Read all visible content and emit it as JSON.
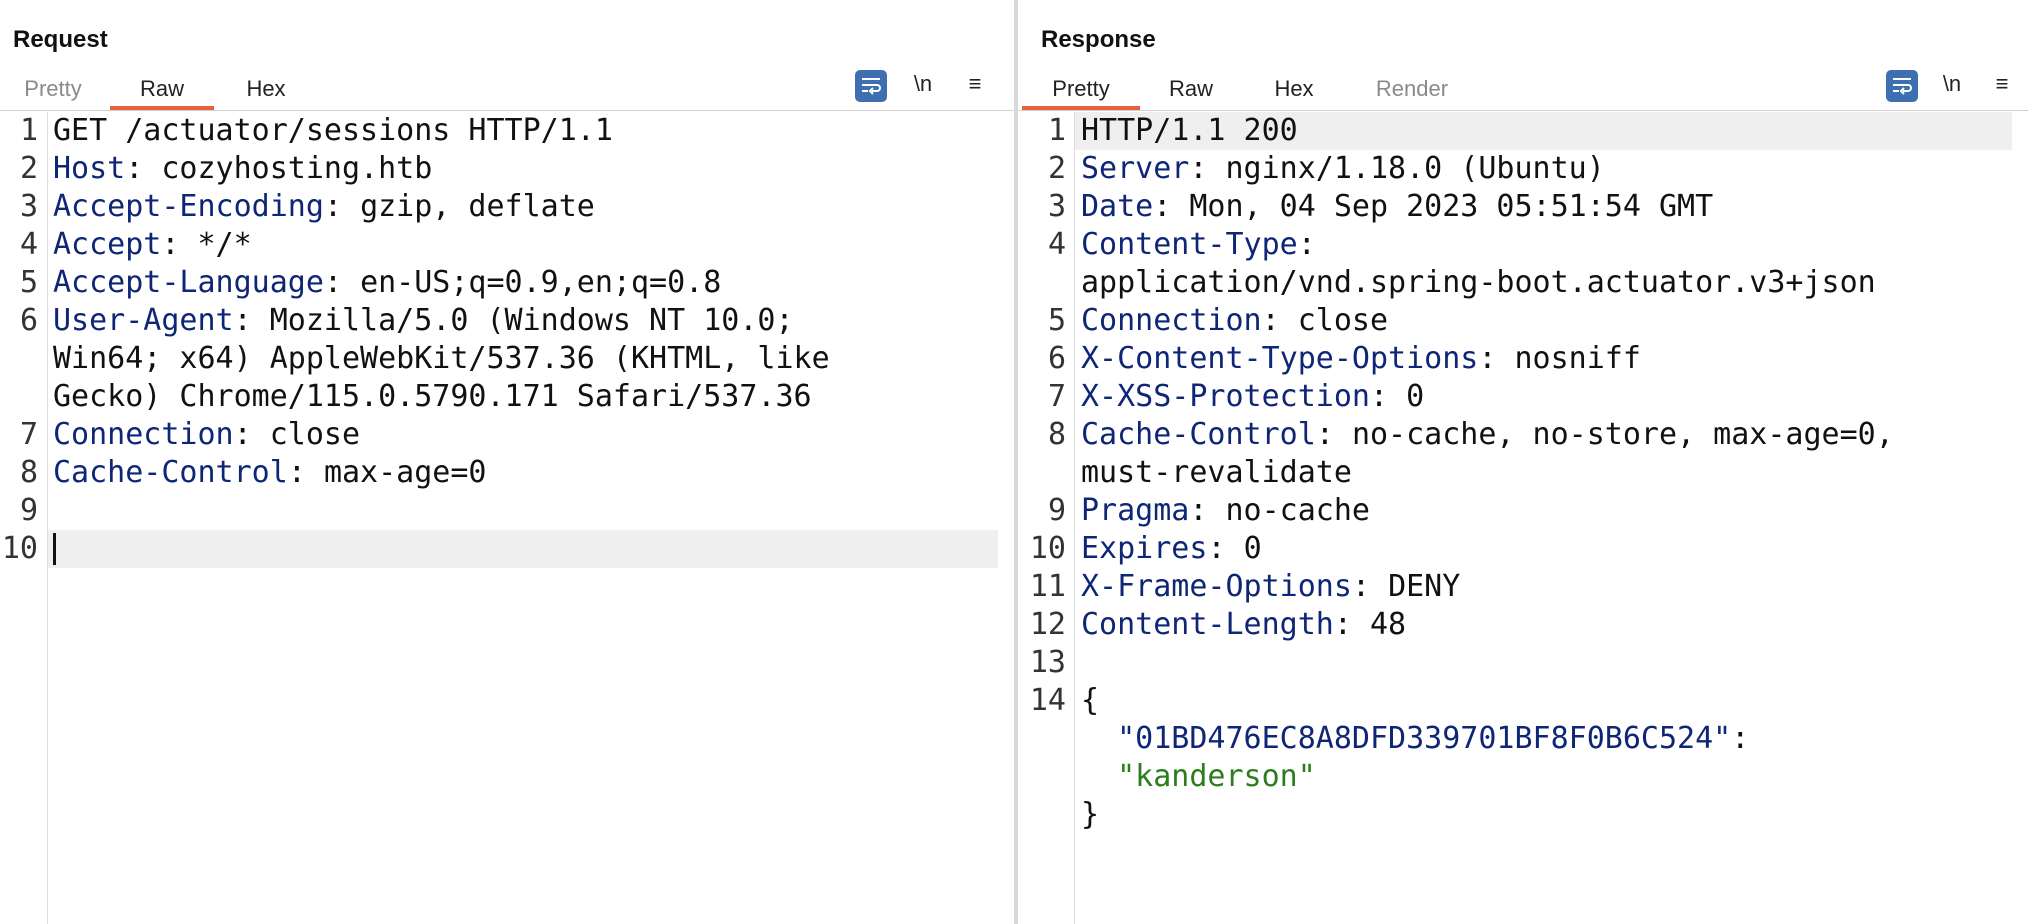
{
  "request": {
    "title": "Request",
    "tabs": [
      {
        "label": "Pretty",
        "active": false
      },
      {
        "label": "Raw",
        "active": true
      },
      {
        "label": "Hex",
        "active": false
      }
    ],
    "tools": {
      "wrap_icon": "wrap-lines-icon",
      "newline_label": "\\n",
      "menu_icon": "hamburger-menu-icon"
    },
    "lines": [
      {
        "n": "1",
        "text": "GET /actuator/sessions HTTP/1.1"
      },
      {
        "n": "2",
        "key": "Host",
        "val": "cozyhosting.htb"
      },
      {
        "n": "3",
        "key": "Accept-Encoding",
        "val": "gzip, deflate"
      },
      {
        "n": "4",
        "key": "Accept",
        "val": "*/*"
      },
      {
        "n": "5",
        "key": "Accept-Language",
        "val": "en-US;q=0.9,en;q=0.8"
      },
      {
        "n": "6",
        "key": "User-Agent",
        "val": "Mozilla/5.0 (Windows NT 10.0;"
      },
      {
        "n": "",
        "text": "Win64; x64) AppleWebKit/537.36 (KHTML, like"
      },
      {
        "n": "",
        "text": "Gecko) Chrome/115.0.5790.171 Safari/537.36"
      },
      {
        "n": "7",
        "key": "Connection",
        "val": "close"
      },
      {
        "n": "8",
        "key": "Cache-Control",
        "val": "max-age=0"
      },
      {
        "n": "9",
        "text": ""
      },
      {
        "n": "10",
        "text": ""
      }
    ]
  },
  "response": {
    "title": "Response",
    "tabs": [
      {
        "label": "Pretty",
        "active": true
      },
      {
        "label": "Raw",
        "active": false
      },
      {
        "label": "Hex",
        "active": false
      },
      {
        "label": "Render",
        "active": false,
        "dim": true
      }
    ],
    "tools": {
      "wrap_icon": "wrap-lines-icon",
      "newline_label": "\\n",
      "menu_icon": "hamburger-menu-icon"
    },
    "lines": [
      {
        "n": "1",
        "text": "HTTP/1.1 200"
      },
      {
        "n": "2",
        "key": "Server",
        "val": "nginx/1.18.0 (Ubuntu)"
      },
      {
        "n": "3",
        "key": "Date",
        "val": "Mon, 04 Sep 2023 05:51:54 GMT"
      },
      {
        "n": "4",
        "key": "Content-Type",
        "val": ""
      },
      {
        "n": "",
        "text": "application/vnd.spring-boot.actuator.v3+json"
      },
      {
        "n": "5",
        "key": "Connection",
        "val": "close"
      },
      {
        "n": "6",
        "key": "X-Content-Type-Options",
        "val": "nosniff"
      },
      {
        "n": "7",
        "key": "X-XSS-Protection",
        "val": "0"
      },
      {
        "n": "8",
        "key": "Cache-Control",
        "val": "no-cache, no-store, max-age=0,"
      },
      {
        "n": "",
        "text": "must-revalidate"
      },
      {
        "n": "9",
        "key": "Pragma",
        "val": "no-cache"
      },
      {
        "n": "10",
        "key": "Expires",
        "val": "0"
      },
      {
        "n": "11",
        "key": "X-Frame-Options",
        "val": "DENY"
      },
      {
        "n": "12",
        "key": "Content-Length",
        "val": "48"
      },
      {
        "n": "13",
        "text": ""
      },
      {
        "n": "14",
        "text": "{"
      },
      {
        "n": "",
        "jkey": "\"01BD476EC8A8DFD339701BF8F0B6C524\"",
        "text": ":"
      },
      {
        "n": "",
        "jval": "\"kanderson\""
      },
      {
        "n": "",
        "text": "}"
      }
    ]
  },
  "layout_buttons": [
    {
      "name": "side-by-side",
      "active": true
    },
    {
      "name": "stacked",
      "active": false
    },
    {
      "name": "single",
      "active": false
    }
  ]
}
